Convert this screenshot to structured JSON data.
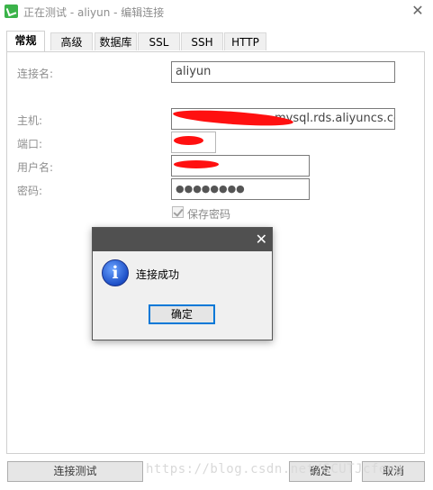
{
  "window": {
    "title": "正在测试 - aliyun - 编辑连接",
    "close_glyph": "✕"
  },
  "tabs": [
    {
      "label": "常规",
      "active": true
    },
    {
      "label": "高级"
    },
    {
      "label": "数据库"
    },
    {
      "label": "SSL"
    },
    {
      "label": "SSH"
    },
    {
      "label": "HTTP"
    }
  ],
  "form": {
    "conn_name_label": "连接名:",
    "conn_name_value": "aliyun",
    "host_label": "主机:",
    "host_value": "mysql.rds.aliyuncs.com",
    "port_label": "端口:",
    "port_value": "",
    "user_label": "用户名:",
    "user_value": "",
    "password_label": "密码:",
    "password_value": "●●●●●●●●",
    "save_password_label": "保存密码"
  },
  "dialog": {
    "close_glyph": "✕",
    "icon": "info-icon",
    "message": "连接成功",
    "ok_label": "确定"
  },
  "bottom": {
    "test_label": "连接测试",
    "ok_label": "确定",
    "cancel_label": "取消"
  },
  "watermark": "https://blog.csdn.net/SCUTJcfeng"
}
